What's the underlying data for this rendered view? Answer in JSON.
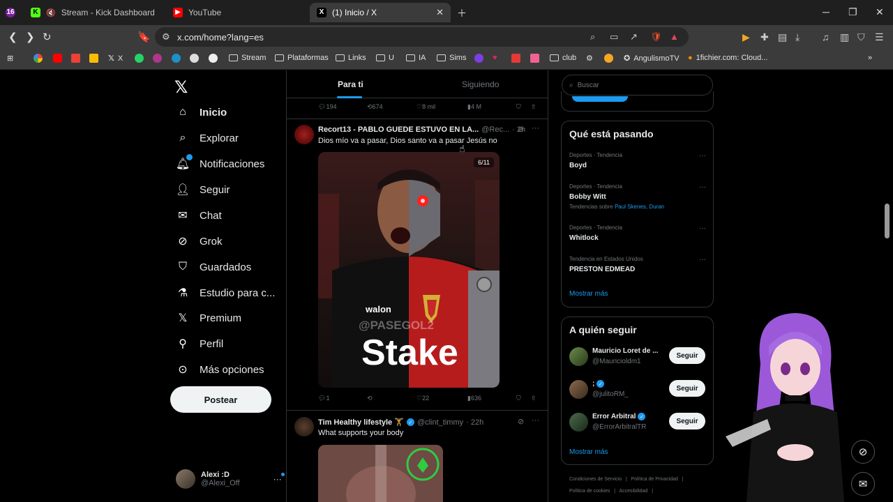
{
  "browser": {
    "tabs": [
      {
        "label": "Stream - Kick Dashboard"
      },
      {
        "label": "YouTube"
      },
      {
        "label": "(1) Inicio / X"
      }
    ],
    "url": "x.com/home?lang=es",
    "bookmarks": [
      "X",
      "Stream",
      "Plataformas",
      "Links",
      "U",
      "IA",
      "Sims",
      "club",
      "AngulismoTV",
      "1fichier.com: Cloud..."
    ]
  },
  "nav": {
    "items": [
      {
        "label": "Inicio",
        "icon": "home-icon"
      },
      {
        "label": "Explorar",
        "icon": "search-icon"
      },
      {
        "label": "Notificaciones",
        "icon": "bell-icon"
      },
      {
        "label": "Seguir",
        "icon": "person-add-icon"
      },
      {
        "label": "Chat",
        "icon": "mail-icon"
      },
      {
        "label": "Grok",
        "icon": "grok-icon"
      },
      {
        "label": "Guardados",
        "icon": "bookmark-icon"
      },
      {
        "label": "Estudio para c...",
        "icon": "studio-icon"
      },
      {
        "label": "Premium",
        "icon": "x-icon"
      },
      {
        "label": "Perfil",
        "icon": "person-icon"
      },
      {
        "label": "Más opciones",
        "icon": "more-circle-icon"
      }
    ],
    "post_label": "Postear",
    "user": {
      "name": "Alexi :D",
      "handle": "@Alexi_Off"
    }
  },
  "feed": {
    "tabs": [
      "Para ti",
      "Siguiendo"
    ],
    "prev_actions": {
      "replies": "194",
      "reposts": "674",
      "likes": "8 mil",
      "views": "4 M"
    },
    "tweet1": {
      "name": "Recort13 - PABLO GUEDE ESTUVO EN LA...",
      "handle": "@Rec...",
      "time": "· 2h",
      "text": "Dios mío va a pasar, Dios santo va a pasar Jesús no",
      "media_counter": "6/11",
      "watermark": "@PASEGOL2",
      "sponsor": "Stake",
      "jersey_text": "walon",
      "actions": {
        "replies": "1",
        "reposts": "",
        "likes": "22",
        "views": "636"
      }
    },
    "tweet2": {
      "name": "Tim Healthy lifestyle 🏋",
      "handle": "@clint_timmy",
      "time": "· 22h",
      "text": "What supports your body"
    }
  },
  "right": {
    "search_placeholder": "Buscar",
    "trending": {
      "title": "Qué está pasando",
      "items": [
        {
          "context": "Deportes · Tendencia",
          "name": "Boyd",
          "sub": "",
          "sub_links": ""
        },
        {
          "context": "Deportes · Tendencia",
          "name": "Bobby Witt",
          "sub": "Tendencias sobre",
          "sub_links": "Paul Skenes, Duran"
        },
        {
          "context": "Deportes · Tendencia",
          "name": "Whitlock",
          "sub": "",
          "sub_links": ""
        },
        {
          "context": "Tendencia en Estados Unidos",
          "name": "PRESTON EDMEAD",
          "sub": "",
          "sub_links": ""
        }
      ],
      "show_more": "Mostrar más"
    },
    "who": {
      "title": "A quién seguir",
      "items": [
        {
          "name": "Mauricio Loret de ...",
          "handle": "@Mauricioldm1",
          "button": "Seguir"
        },
        {
          "name": ";",
          "handle": "@julitoRM_",
          "button": "Seguir"
        },
        {
          "name": "Error Arbitral",
          "handle": "@ErrorArbitralTR",
          "button": "Seguir"
        }
      ],
      "show_more": "Mostrar más"
    },
    "footer": [
      "Condiciones de Servicio",
      "|",
      "Política de Privacidad",
      "|",
      "Política de cookies",
      "|",
      "Accesibilidad",
      "|"
    ]
  },
  "colors": {
    "accent": "#1d9bf0",
    "background": "#000000",
    "muted": "#71767b"
  }
}
